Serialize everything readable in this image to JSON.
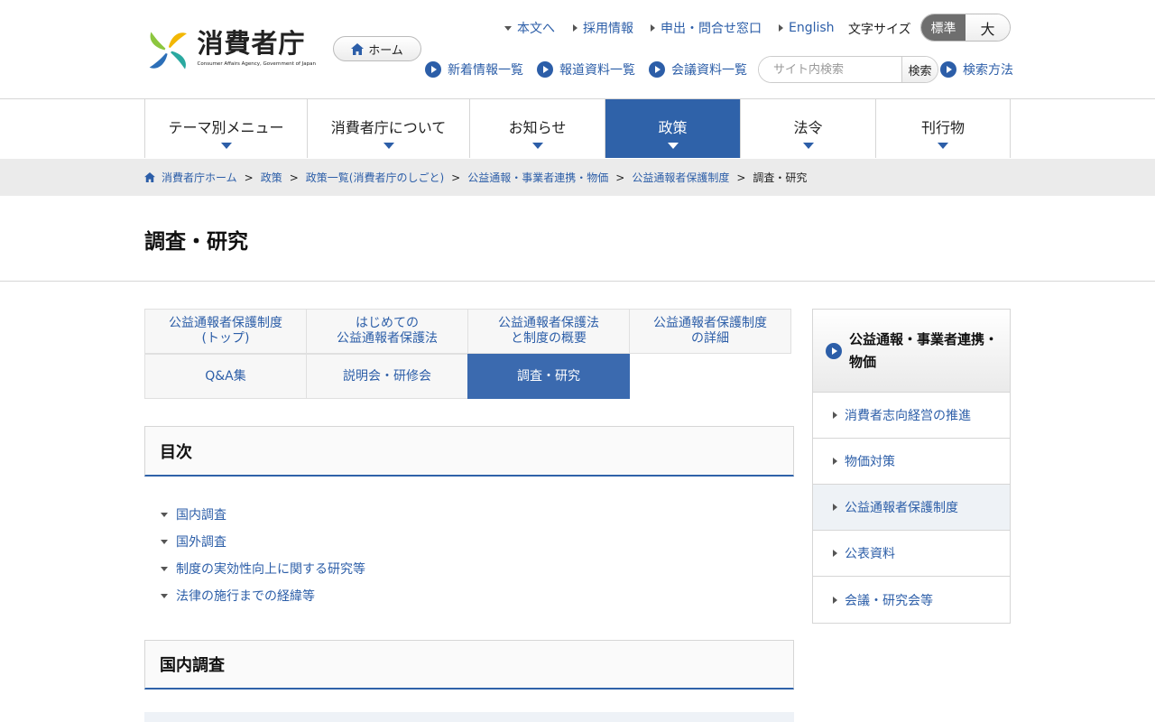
{
  "header": {
    "logo_title": "消費者庁",
    "logo_subtitle": "Consumer Affairs Agency, Government of Japan",
    "home_button": "ホーム",
    "util_links": [
      "本文へ",
      "採用情報",
      "申出・問合せ窓口",
      "English"
    ],
    "font_size_label": "文字サイズ",
    "font_size_standard": "標準",
    "font_size_large": "大",
    "quick_links": [
      "新着情報一覧",
      "報道資料一覧",
      "会議資料一覧"
    ],
    "search_placeholder": "サイト内検索",
    "search_button": "検索",
    "search_help": "検索方法"
  },
  "global_nav": [
    {
      "label": "テーマ別メニュー"
    },
    {
      "label": "消費者庁について"
    },
    {
      "label": "お知らせ"
    },
    {
      "label": "政策",
      "active": true
    },
    {
      "label": "法令"
    },
    {
      "label": "刊行物"
    }
  ],
  "breadcrumb": {
    "items": [
      "消費者庁ホーム",
      "政策",
      "政策一覧(消費者庁のしごと)",
      "公益通報・事業者連携・物価",
      "公益通報者保護制度"
    ],
    "current": "調査・研究",
    "separator": ">"
  },
  "page_title": "調査・研究",
  "tabs": {
    "row1": [
      {
        "line1": "公益通報者保護制度",
        "line2": "(トップ)"
      },
      {
        "line1": "はじめての",
        "line2": "公益通報者保護法"
      },
      {
        "line1": "公益通報者保護法",
        "line2": "と制度の概要"
      },
      {
        "line1": "公益通報者保護制度",
        "line2": "の詳細"
      }
    ],
    "row2": [
      {
        "line1": "Q&A集"
      },
      {
        "line1": "説明会・研修会"
      },
      {
        "line1": "調査・研究",
        "active": true
      }
    ]
  },
  "toc": {
    "heading": "目次",
    "items": [
      "国内調査",
      "国外調査",
      "制度の実効性向上に関する研究等",
      "法律の施行までの経緯等"
    ]
  },
  "section_heading": "国内調査",
  "side_nav": {
    "heading": "公益通報・事業者連携・物価",
    "items": [
      {
        "label": "消費者志向経営の推進"
      },
      {
        "label": "物価対策"
      },
      {
        "label": "公益通報者保護制度",
        "current": true
      },
      {
        "label": "公表資料"
      },
      {
        "label": "会議・研究会等"
      }
    ]
  },
  "colors": {
    "accent": "#2f62a9",
    "link": "#2c5ea8",
    "tab_active": "#3b6aaf",
    "breadcrumb_bg": "#ebebeb"
  },
  "icons": [
    "logo-pinwheel-icon",
    "home-icon",
    "triangle-down-icon",
    "triangle-right-icon",
    "circle-arrow-icon",
    "caret-down-icon"
  ]
}
